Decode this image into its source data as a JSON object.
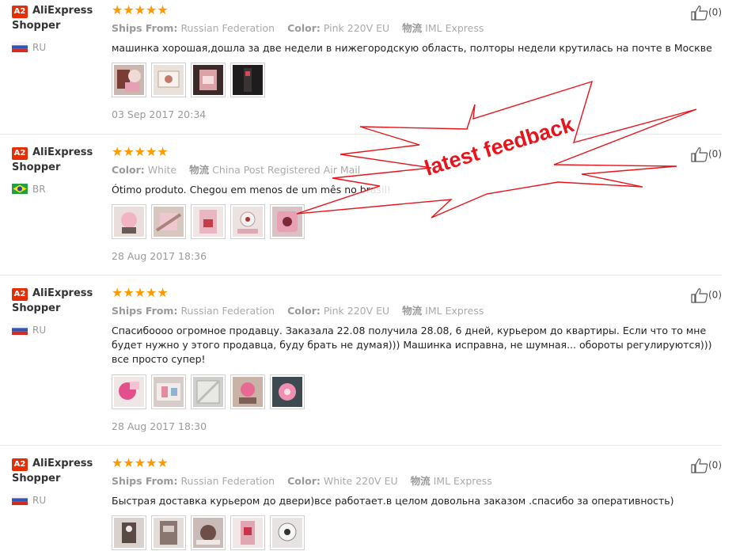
{
  "reviews": [
    {
      "badge": "A2",
      "user_line1": "AliExpress",
      "user_line2": "Shopper",
      "country": "RU",
      "flag": "ru",
      "stars": "★★★★★",
      "meta": [
        {
          "label": "Ships From:",
          "value": "Russian Federation"
        },
        {
          "label": "Color:",
          "value": "Pink 220V EU"
        },
        {
          "label": "物流",
          "value": "IML Express"
        }
      ],
      "text": "машинка хорошая,дошла за две недели в нижегородскую область, полторы недели крутилась на почте в Москве",
      "photos": 4,
      "date": "03 Sep 2017 20:34",
      "likes": "(0)"
    },
    {
      "badge": "A2",
      "user_line1": "AliExpress",
      "user_line2": "Shopper",
      "country": "BR",
      "flag": "br",
      "stars": "★★★★★",
      "meta": [
        {
          "label": "Color:",
          "value": "White"
        },
        {
          "label": "物流",
          "value": "China Post Registered Air Mail"
        }
      ],
      "text": "Ótimo produto. Chegou em menos de um mês no brasil!",
      "photos": 5,
      "date": "28 Aug 2017 18:36",
      "likes": "(0)"
    },
    {
      "badge": "A2",
      "user_line1": "AliExpress",
      "user_line2": "Shopper",
      "country": "RU",
      "flag": "ru",
      "stars": "★★★★★",
      "meta": [
        {
          "label": "Ships From:",
          "value": "Russian Federation"
        },
        {
          "label": "Color:",
          "value": "Pink 220V EU"
        },
        {
          "label": "物流",
          "value": "IML Express"
        }
      ],
      "text": "Спасибоооо огромное продавцу. Заказала 22.08 получила 28.08, 6 дней, курьером до квартиры. Если что то мне будет нужно у этого продавца, буду брать не думая))) Машинка исправна, не шумная... обороты регулируются))) все просто супер!",
      "photos": 5,
      "date": "28 Aug 2017 18:30",
      "likes": "(0)"
    },
    {
      "badge": "A2",
      "user_line1": "AliExpress",
      "user_line2": "Shopper",
      "country": "RU",
      "flag": "ru",
      "stars": "★★★★★",
      "meta": [
        {
          "label": "Ships From:",
          "value": "Russian Federation"
        },
        {
          "label": "Color:",
          "value": "White 220V EU"
        },
        {
          "label": "物流",
          "value": "IML Express"
        }
      ],
      "text": "Быстрая доставка курьером до двери)все работает.в целом довольна заказом .спасибо за оперативность)",
      "photos": 5,
      "date": "",
      "likes": "(0)"
    }
  ],
  "overlay": {
    "text": "latest feedback",
    "color": "#e8141b"
  }
}
